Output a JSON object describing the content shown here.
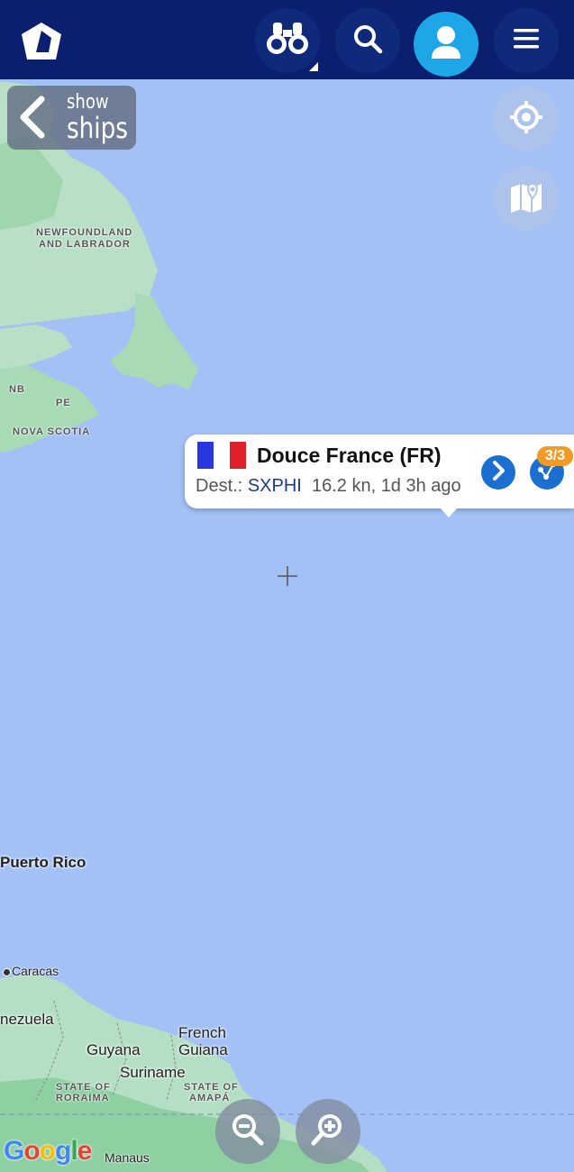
{
  "header": {
    "logo_icon": "logo-pentagon-icon",
    "buttons": [
      {
        "name": "binoculars",
        "icon": "binoculars-icon"
      },
      {
        "name": "search",
        "icon": "search-icon"
      },
      {
        "name": "account",
        "icon": "user-icon"
      },
      {
        "name": "menu",
        "icon": "hamburger-menu-icon"
      }
    ],
    "colors": {
      "bar": "#0a1f6e",
      "active": "#1ea7e8"
    }
  },
  "show_ships": {
    "line1": "show",
    "line2": "ships"
  },
  "vessel_popup": {
    "name": "Douce France (FR)",
    "flag": [
      "#2a36e0",
      "#ffffff",
      "#e0202a"
    ],
    "dest_label": "Dest.:",
    "dest_code": "SXPHI",
    "status": "16.2 kn, 1d 3h ago",
    "route_badge": "3/3"
  },
  "map_labels": {
    "newfoundland_1": "NEWFOUNDLAND",
    "newfoundland_2": "AND LABRADOR",
    "nb": "NB",
    "pe": "PE",
    "nova_scotia": "NOVA SCOTIA",
    "puerto_rico": "Puerto Rico",
    "caracas": "Caracas",
    "venezuela": "nezuela",
    "guyana": "Guyana",
    "suriname": "Suriname",
    "french_guiana_1": "French",
    "french_guiana_2": "Guiana",
    "roraima_1": "STATE OF",
    "roraima_2": "RORAIMA",
    "amapa_1": "STATE OF",
    "amapa_2": "AMAPÁ",
    "manaus": "Manaus"
  },
  "attribution": "Google",
  "colors": {
    "ocean": "#a3c1f5",
    "land": "#b5dfc4",
    "land_green": "#8fd0a3"
  }
}
